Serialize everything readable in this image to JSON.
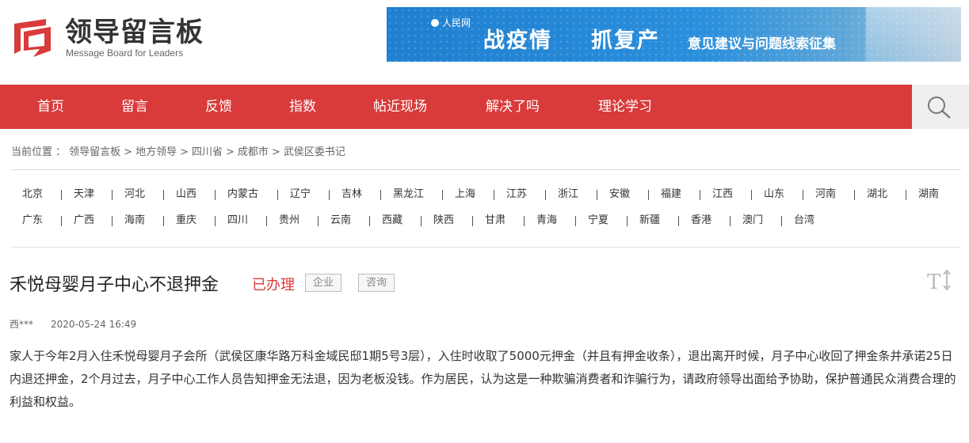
{
  "site": {
    "title": "领导留言板",
    "subtitle": "Message Board for Leaders"
  },
  "banner": {
    "source": "人民网",
    "headline_a": "战疫情",
    "headline_b": "抓复产",
    "tagline": "意见建议与问题线索征集"
  },
  "nav": {
    "items": [
      "首页",
      "留言",
      "反馈",
      "指数",
      "帖近现场",
      "解决了吗",
      "理论学习"
    ]
  },
  "breadcrumb": {
    "prefix": "当前位置 ：",
    "items": [
      "领导留言板",
      ">",
      "地方领导",
      ">",
      "四川省",
      ">",
      "成都市",
      ">",
      "武侯区委书记"
    ]
  },
  "regions": {
    "row1": [
      "北京",
      "天津",
      "河北",
      "山西",
      "内蒙古",
      "辽宁",
      "吉林",
      "黑龙江",
      "上海",
      "江苏",
      "浙江",
      "安徽",
      "福建",
      "江西",
      "山东",
      "河南",
      "湖北",
      "湖南"
    ],
    "row2": [
      "广东",
      "广西",
      "海南",
      "重庆",
      "四川",
      "贵州",
      "云南",
      "西藏",
      "陕西",
      "甘肃",
      "青海",
      "宁夏",
      "新疆",
      "香港",
      "澳门",
      "台湾"
    ]
  },
  "post": {
    "title": "禾悦母婴月子中心不退押金",
    "status": "已办理",
    "tags": [
      "企业",
      "咨询"
    ],
    "author": "西***",
    "date": "2020-05-24 16:49",
    "body": "家人于今年2月入住禾悦母婴月子会所（武侯区康华路万科金域民邸1期5号3层），入住时收取了5000元押金（并且有押金收条），退出离开时候，月子中心收回了押金条并承诺25日内退还押金，2个月过去，月子中心工作人员告知押金无法退，因为老板没钱。作为居民，认为这是一种欺骗消费者和诈骗行为，请政府领导出面给予协助，保护普通民众消费合理的利益和权益。"
  },
  "colors": {
    "brand_red": "#d93a3a",
    "banner_blue": "#1f7fd0"
  }
}
